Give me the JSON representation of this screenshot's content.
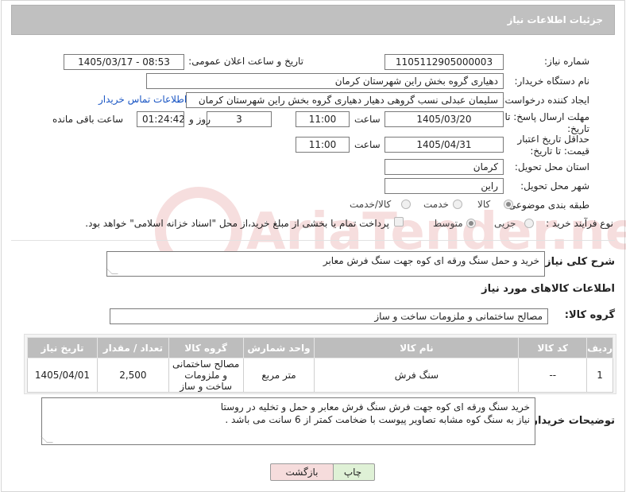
{
  "header": {
    "title": "جزئیات اطلاعات نیاز"
  },
  "watermark": {
    "text": "AriaTender.net"
  },
  "fields": {
    "need_number_label": "شماره نیاز:",
    "need_number": "1105112905000003",
    "announce_label": "تاریخ و ساعت اعلان عمومی:",
    "announce_value": "1405/03/17 - 08:53",
    "buyer_org_label": "نام دستگاه خریدار:",
    "buyer_org": "دهیاری گروه بخش راین شهرستان کرمان",
    "creator_label": "ایجاد کننده درخواست:",
    "creator": "سلیمان عبدلی نسب گروهی دهیار دهیاری گروه بخش راین شهرستان کرمان",
    "contact_link": "اطلاعات تماس خریدار",
    "deadline_label": "مهلت ارسال پاسخ: تا تاریخ:",
    "deadline_date": "1405/03/20",
    "time_label": "ساعت",
    "deadline_time": "11:00",
    "days_value": "3",
    "days_label": "روز و",
    "remaining_time": "01:24:42",
    "remaining_label": "ساعت باقی مانده",
    "validity_label": "حداقل تاریخ اعتبار قیمت: تا تاریخ:",
    "validity_date": "1405/04/31",
    "validity_time": "11:00",
    "province_label": "استان محل تحویل:",
    "province": "کرمان",
    "city_label": "شهر محل تحویل:",
    "city": "راین",
    "category_label": "طبقه بندی موضوعی:",
    "category_options": [
      "کالا",
      "خدمت",
      "کالا/خدمت"
    ],
    "process_label": "نوع فرآیند خرید :",
    "process_options": [
      "جزیی",
      "متوسط"
    ],
    "process_note": "پرداخت تمام یا بخشی از مبلغ خرید،از محل \"اسناد خزانه اسلامی\" خواهد بود.",
    "description_label": "شرح کلی نیاز:",
    "description": "خرید و حمل سنگ ورقه ای کوه جهت سنگ فرش معابر"
  },
  "goods": {
    "section_title": "اطلاعات کالاهای مورد نیاز",
    "group_label": "گروه کالا:",
    "group_value": "مصالح ساختمانی و ملزومات ساخت و ساز",
    "columns": [
      "ردیف",
      "کد کالا",
      "نام کالا",
      "واحد شمارش",
      "گروه کالا",
      "تعداد / مقدار",
      "تاریخ نیاز"
    ],
    "rows": [
      [
        "1",
        "--",
        "سنگ فرش",
        "متر مربع",
        "مصالح ساختمانی و ملزومات ساخت و ساز",
        "2,500",
        "1405/04/01"
      ]
    ]
  },
  "buyer_notes": {
    "label": "توضیحات خریدار:",
    "line1": "خرید سنگ ورقه ای کوه  جهت فرش سنگ فرش معابر و حمل و تخلیه در روستا",
    "line2": "نیاز به سنگ کوه مشابه تصاویر پیوست با ضخامت کمتر از 6 سانت می باشد ."
  },
  "buttons": {
    "print": "چاپ",
    "back": "بازگشت"
  }
}
